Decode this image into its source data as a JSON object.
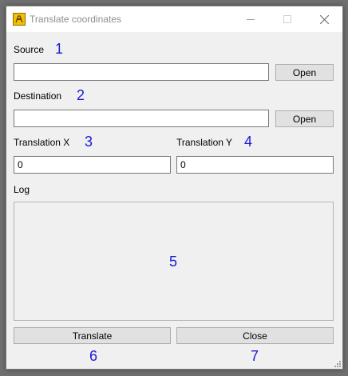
{
  "window": {
    "title": "Translate coordinates",
    "icon": "app-icon",
    "controls": {
      "minimize": "minimize-icon",
      "maximize": "maximize-icon",
      "close": "close-icon"
    }
  },
  "source": {
    "label": "Source",
    "marker": "1",
    "value": "",
    "open_label": "Open"
  },
  "destination": {
    "label": "Destination",
    "marker": "2",
    "value": "",
    "open_label": "Open"
  },
  "translation_x": {
    "label": "Translation X",
    "marker": "3",
    "value": "0"
  },
  "translation_y": {
    "label": "Translation Y",
    "marker": "4",
    "value": "0"
  },
  "log": {
    "label": "Log",
    "marker": "5",
    "content": ""
  },
  "buttons": {
    "translate_label": "Translate",
    "translate_marker": "6",
    "close_label": "Close",
    "close_marker": "7"
  },
  "colors": {
    "marker": "#1a1ad6",
    "background": "#f0f0f0",
    "button": "#e1e1e1"
  }
}
